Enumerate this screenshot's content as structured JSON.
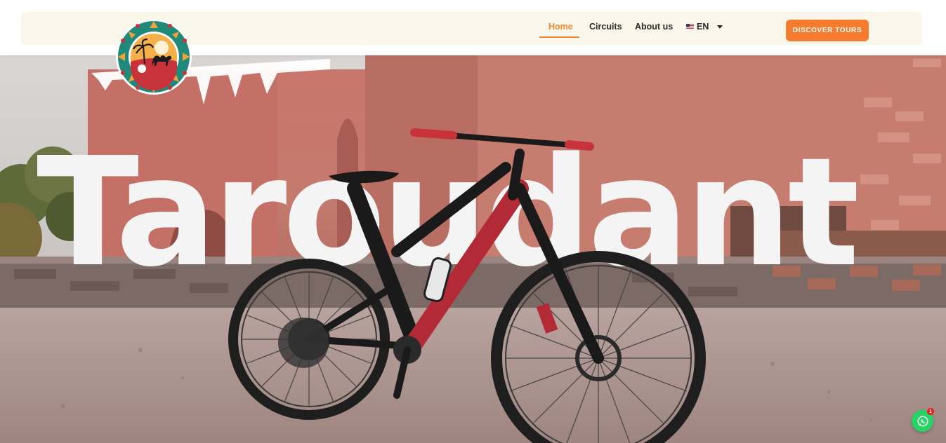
{
  "nav": {
    "items": [
      {
        "label": "Home",
        "active": true
      },
      {
        "label": "Circuits",
        "active": false
      },
      {
        "label": "About us",
        "active": false
      }
    ],
    "language": {
      "label": "EN",
      "flag_icon": "us-flag-icon",
      "dropdown_icon": "caret-down-icon"
    },
    "cta_label": "DISCOVER TOURS"
  },
  "logo": {
    "icon": "camel-palm-sun-logo"
  },
  "hero": {
    "title": "Taroudant",
    "image": "red mountain bike in front of kasbah walls"
  },
  "whatsapp": {
    "icon": "whatsapp-icon",
    "badge_count": "1"
  },
  "colors": {
    "accent": "#f57c2e",
    "nav_active": "#f28a35",
    "header_bg": "#faf6ea",
    "whatsapp": "#25d366"
  }
}
